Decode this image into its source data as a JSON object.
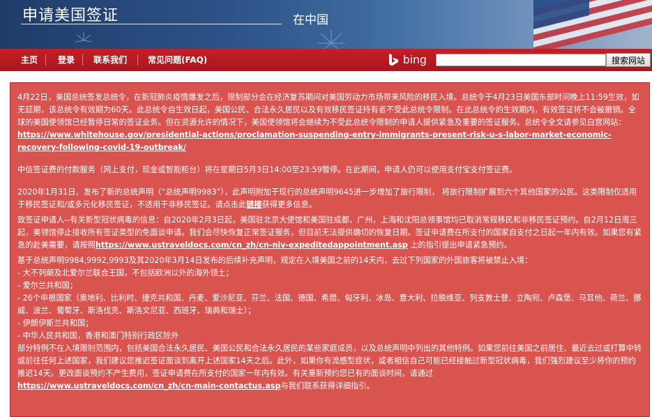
{
  "header": {
    "title": "申请美国签证",
    "subtitle": "在中国"
  },
  "nav": {
    "home": "主页",
    "login": "登录",
    "contact": "联系我们",
    "faq": "常见问题(FAQ)",
    "bing_label": "bing",
    "search_placeholder": "",
    "search_button": "搜索网站"
  },
  "alert": {
    "p1_text": "4月22日，美国总统签发总统令，在新冠肺炎疫情爆发之后，限制部分会在经济复苏期间对美国劳动力市场带来风险的移民入境。总统令于4月23日美国东部时间晚上11:59生效，如无延期，该总统令有效期为60天。此总统令自生效日起，美国公民、合法永久居民以及有效移民签证持有者不受此总统令限制。在此总统令的生效期内，有效签证将不会被撤销。全球的美国使领馆已经暂停日常的签证业务。但在资源允许的情况下，美国使领馆将会继续为不受此总统令限制的申请人提供紧急及重要的签证服务。总统令全文请参见白宫网站：",
    "p1_link": "https://www.whitehouse.gov/presidential-actions/proclamation-suspending-entry-immigrants-present-risk-u-s-labor-market-economic-recovery-following-covid-19-outbreak/",
    "p2_text": "中信签证费的付款服务（网上支付，现金或智能柜台）将在星期日5月3日14:00至23:59暂停。在此期间，申请人仍可以使用支付宝支付签证费。",
    "p3_text_a": "2020年1月31日，发布了新的总统声明（“总统声明9983”），此声明附加于现行的总统声明9645进一步增加了旅行限制， 将旅行限制扩展到六个其他国家的公民。这类限制仅适用于移民签证和/或多元化移民签证，不适用于非移民签证。请点击此",
    "p3_link": "链接",
    "p3_text_b": "获得更多信息。",
    "p4_text_a": "致签证申请人--有关新型冠状病毒的信息：自2020年2月3日起，美国驻北京大使馆和美国驻成都，广州，上海和沈阳总领事馆均已取消常规移民和非移民签证预约。自2月12日周三起，美领馆停止接收所有签证类型的免面谈申请。我们会尽快恢复正常签证服务，但目前无法提供确切的恢复日期。签证申请费在所支付的国家自支付之日起一年内有效。如果您有紧急的赴美需要，请按照",
    "p4_link": "https://www.ustraveldocs.com/cn_zh/cn-niv-expeditedappointment.asp",
    "p4_text_b": " 上的指引提出申请紧急预约。",
    "p5_intro": "基于总统声明9984,9992,9993及其2020年3月14日发布的后续补充声明，规定在入境美国之前的14天内，去过下列国家的外国旅客将被禁止入境：",
    "p5_l1": "- 大不列颠及北爱尔兰联合王国，不包括欧洲以外的海外领土；",
    "p5_l2": "- 爱尔兰共和国；",
    "p5_l3": "- 26个申根国家（奥地利、比利时、捷克共和国、丹麦、爱沙尼亚、芬兰、法国、德国、希腊、匈牙利、冰岛、意大利、拉脱维亚、列支敦士登、立陶宛、卢森堡、马耳他、荷兰、挪威、波兰、葡萄牙、斯洛伐克、斯洛文尼亚、西班牙、瑞典和瑞士）；",
    "p5_l4": "- 伊朗伊斯兰共和国；",
    "p5_l5": "- 中华人民共和国，香港和澳门特别行政区除外",
    "p5_text": "部分特例不在入境限制范围内，包括美国合法永久居民、美国公民和合法永久居民的某些家庭成员，以及总统声明中列出的其他特例。如果您前往美国之前居住、最近去过或打算中转或前往任何上述国家，我们建议您推迟签证面谈到离开上述国家14天之后。此外，如果你有流感型症状，或者相信自己可能已经接触过新型冠状病毒，我们强烈建议至少将你的预约推迟14天。更改面谈预约不产生费用，签证申请费在所支付的国家一年内有效。有关重新预约您已有的面谈时间，请通过",
    "p5_link": "https://www.ustraveldocs.com/cn_zh/cn-main-contactus.asp",
    "p5_tail": "与我们联系获得详细指引。"
  },
  "colors": {
    "nav_red": "#b81c22",
    "alert_bg": "#d9534f",
    "banner_blue": "#2d5288"
  }
}
